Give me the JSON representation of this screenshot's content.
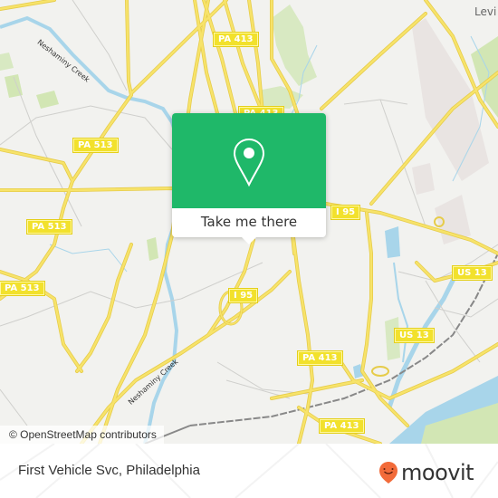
{
  "map": {
    "place_labels": [
      {
        "text": "Levi",
        "name": "place-label-levittown"
      }
    ],
    "waterway_labels": [
      {
        "text": "Neshaminy Creek",
        "name": "waterway-label-neshaminy-creek-north"
      },
      {
        "text": "Neshaminy Creek",
        "name": "waterway-label-neshaminy-creek-south"
      }
    ],
    "route_shields": [
      {
        "text": "PA 413",
        "name": "route-shield-pa-413"
      },
      {
        "text": "PA 413",
        "name": "route-shield-pa-413"
      },
      {
        "text": "PA 513",
        "name": "route-shield-pa-513"
      },
      {
        "text": "PA 513",
        "name": "route-shield-pa-513"
      },
      {
        "text": "PA 513",
        "name": "route-shield-pa-513"
      },
      {
        "text": "I 95",
        "name": "route-shield-i-95"
      },
      {
        "text": "I 95",
        "name": "route-shield-i-95"
      },
      {
        "text": "US 13",
        "name": "route-shield-us-13"
      },
      {
        "text": "US 13",
        "name": "route-shield-us-13"
      },
      {
        "text": "PA 413",
        "name": "route-shield-pa-413"
      },
      {
        "text": "PA 413",
        "name": "route-shield-pa-413"
      }
    ],
    "attribution": "© OpenStreetMap contributors",
    "colors": {
      "land": "#f2f2ef",
      "road": "#f7e36a",
      "road_casing": "#e6cc4a",
      "water": "#a8d5ea",
      "park": "#d2e6b4",
      "industrial": "#e9e4e2",
      "rail": "#888888"
    }
  },
  "popup": {
    "icon": "map-pin-icon",
    "button_label": "Take me there",
    "color": "#1fb869"
  },
  "footer": {
    "location_title": "First Vehicle Svc, Philadelphia",
    "brand": "moovit",
    "brand_color": "#f26b3a"
  }
}
